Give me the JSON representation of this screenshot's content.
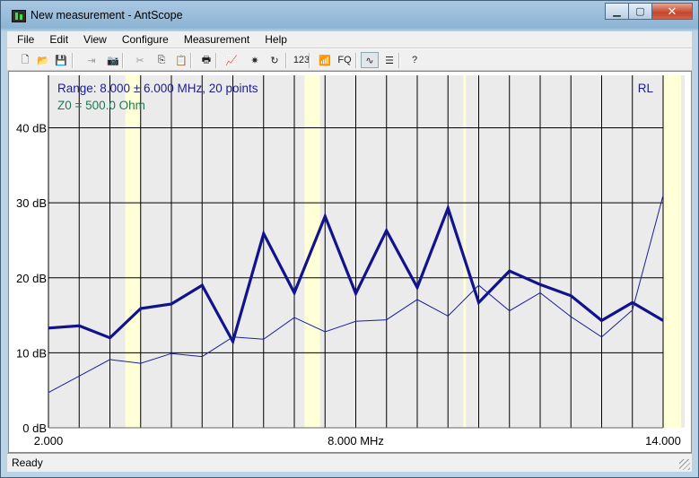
{
  "window": {
    "title": "New measurement - AntScope"
  },
  "menu": [
    "File",
    "Edit",
    "View",
    "Configure",
    "Measurement",
    "Help"
  ],
  "toolbar": {
    "items": [
      {
        "icon": "new-file-icon",
        "glyph": "🗋"
      },
      {
        "icon": "open-folder-icon",
        "glyph": "📂"
      },
      {
        "icon": "save-icon",
        "glyph": "💾"
      },
      {
        "icon": "export-icon",
        "glyph": "⇥",
        "disabled": true
      },
      {
        "icon": "camera-icon",
        "glyph": "📷"
      },
      {
        "icon": "cut-icon",
        "glyph": "✂",
        "disabled": true
      },
      {
        "icon": "copy-icon",
        "glyph": "⎘"
      },
      {
        "icon": "paste-icon",
        "glyph": "📋",
        "disabled": true
      },
      {
        "icon": "print-icon",
        "glyph": "🖶"
      },
      {
        "icon": "chart-icon",
        "glyph": "📈"
      },
      {
        "icon": "calibrate-icon",
        "glyph": "✷"
      },
      {
        "icon": "refresh-icon",
        "glyph": "↻"
      },
      {
        "icon": "numeric-icon",
        "glyph": "123"
      },
      {
        "icon": "antenna-icon",
        "glyph": "📶"
      },
      {
        "icon": "fq-icon",
        "glyph": "FQ"
      },
      {
        "icon": "curve-icon",
        "glyph": "∿",
        "pressed": true
      },
      {
        "icon": "list-icon",
        "glyph": "☰"
      },
      {
        "icon": "help-icon",
        "glyph": "?"
      }
    ]
  },
  "status": {
    "text": "Ready"
  },
  "colors": {
    "thick": "#10138c",
    "thin": "#1a1f9a",
    "band": "#ffffd8",
    "grid": "#000000",
    "bg": "#ebebeb",
    "range_text": "#1c1c8c",
    "z0_text": "#1a7a55"
  },
  "chart_data": {
    "type": "line",
    "info_range": "Range: 8.000 ± 6.000 MHz, 20 points",
    "info_z0": "Z0 = 500.0 Ohm",
    "mode_label": "RL",
    "x_tick_labels": [
      "2.000",
      "8.000 MHz",
      "14.000"
    ],
    "y_tick_labels": [
      "0 dB",
      "10 dB",
      "20 dB",
      "30 dB",
      "40 dB"
    ],
    "xlim": [
      2.0,
      14.0
    ],
    "ylim": [
      0,
      47
    ],
    "grid": true,
    "x": [
      2.0,
      2.6,
      3.2,
      3.8,
      4.4,
      5.0,
      5.6,
      6.2,
      6.8,
      7.4,
      8.0,
      8.6,
      9.2,
      9.8,
      10.4,
      11.0,
      11.6,
      12.2,
      12.8,
      13.4,
      14.0
    ],
    "series": [
      {
        "values": [
          13.3,
          13.6,
          12.0,
          15.9,
          16.5,
          19.0,
          11.5,
          25.9,
          18.0,
          28.2,
          17.9,
          26.3,
          18.7,
          29.3,
          16.7,
          20.9,
          19.1,
          17.6,
          14.3,
          16.7,
          14.3
        ]
      },
      {
        "values": [
          4.7,
          6.9,
          9.1,
          8.6,
          9.9,
          9.5,
          12.1,
          11.8,
          14.7,
          12.8,
          14.2,
          14.4,
          17.1,
          14.9,
          19.0,
          15.6,
          18.0,
          14.8,
          12.1,
          15.7,
          31.0
        ]
      }
    ],
    "bands": [
      [
        3.5,
        3.8
      ],
      [
        7.0,
        7.3
      ],
      [
        10.1,
        10.15
      ],
      [
        14.0,
        14.35
      ]
    ]
  }
}
